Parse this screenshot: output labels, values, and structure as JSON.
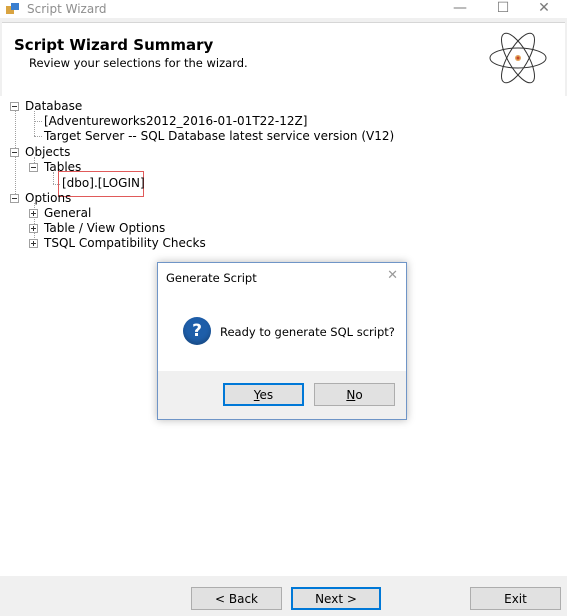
{
  "window": {
    "title": "Script Wizard",
    "minimize_glyph": "—",
    "maximize_glyph": "☐",
    "close_glyph": "✕"
  },
  "header": {
    "title": "Script Wizard Summary",
    "subtitle": "Review your selections for the wizard."
  },
  "tree": {
    "database": {
      "label": "Database",
      "children": [
        "[Adventureworks2012_2016-01-01T22-12Z]",
        "Target Server -- SQL Database latest service version (V12)"
      ]
    },
    "objects": {
      "label": "Objects",
      "tables_label": "Tables",
      "table_item": "[dbo].[LOGIN]"
    },
    "options": {
      "label": "Options",
      "children": [
        "General",
        "Table / View Options",
        "TSQL Compatibility Checks"
      ]
    }
  },
  "footer": {
    "back": "< Back",
    "next": "Next >",
    "exit": "Exit"
  },
  "dialog": {
    "title": "Generate Script",
    "close_glyph": "✕",
    "icon_glyph": "?",
    "message": "Ready to generate SQL script?",
    "yes_first": "Y",
    "yes_rest": "es",
    "no_first": "N",
    "no_rest": "o"
  },
  "colors": {
    "highlight_border": "#e05a5a",
    "focus_border": "#0078d7",
    "question_icon": "#1e5ea9"
  }
}
